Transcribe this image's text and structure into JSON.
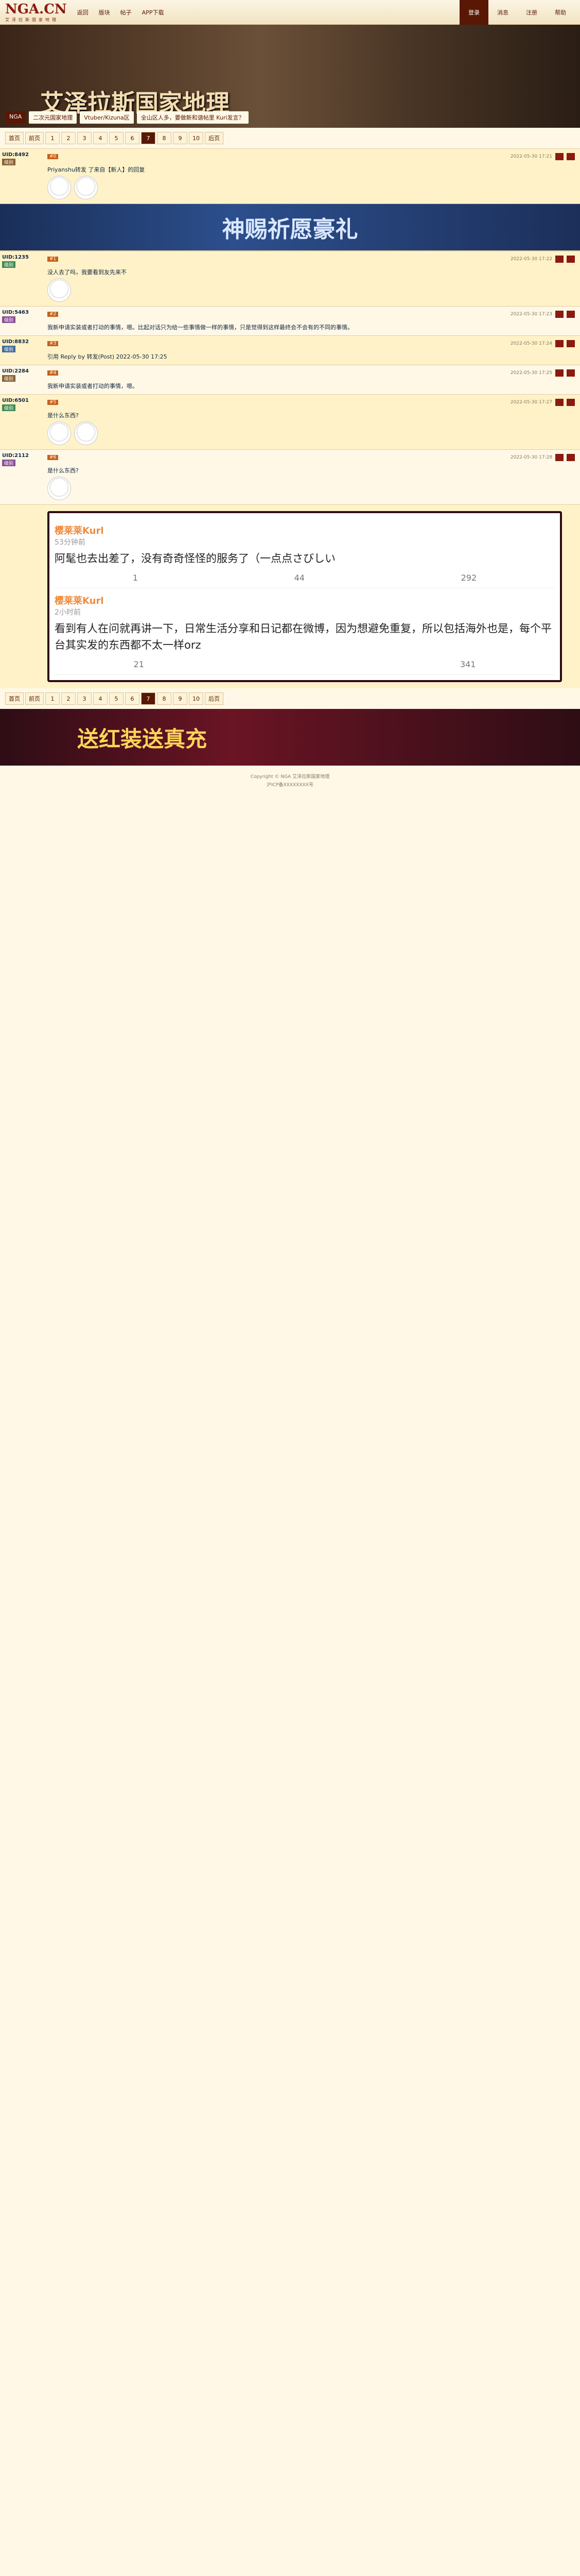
{
  "top": {
    "logo": "NGA.CN",
    "logo_sub": "艾泽拉斯国家地理",
    "nav": [
      "返回",
      "版块",
      "帖子",
      "APP下载"
    ],
    "right": [
      "登录",
      "消息",
      "注册",
      "帮助"
    ]
  },
  "banner": {
    "title": "艾泽拉斯国家地理",
    "bread": [
      "NGA",
      "二次元国家地理",
      "Vtuber/Kizuna区",
      "全山区人多，要做新和谐帖里 Kuri发言？"
    ]
  },
  "pager": [
    "首页",
    "前页",
    "1",
    "2",
    "3",
    "4",
    "5",
    "6",
    "7",
    "8",
    "9",
    "10",
    "后页"
  ],
  "pager_current": "7",
  "posts": [
    {
      "user": "UID:8492",
      "badge": "级别",
      "time": "2022-05-30 17:21",
      "floor": "#0",
      "text": "Priyanshu转发 了来自【新人】的回复",
      "emo": 2,
      "extra": "[emo]"
    },
    {
      "user": "UID:1235",
      "badge": "级别",
      "time": "2022-05-30 17:22",
      "floor": "#1",
      "text": "没人去了吗，我要看到友先来不",
      "emo": 1
    },
    {
      "user": "UID:5463",
      "badge": "级别",
      "time": "2022-05-30 17:23",
      "floor": "#2",
      "text": "我新申请实装或者打动的事情，嗯。比起对话只为给一些事情做一样的事情，只是觉得到这样最终会不会有的不同的事情。",
      "emo": 0
    },
    {
      "user": "UID:8832",
      "badge": "级别",
      "time": "2022-05-30 17:24",
      "floor": "#3",
      "text": "引用 Reply by 转发(Post) 2022-05-30 17:25",
      "emo": 0
    },
    {
      "user": "UID:2284",
      "badge": "级别",
      "time": "2022-05-30 17:25",
      "floor": "#4",
      "text": "我新申请实装或者打动的事情，嗯。",
      "emo": 0
    },
    {
      "user": "UID:6501",
      "badge": "级别",
      "time": "2022-05-30 17:27",
      "floor": "#5",
      "text": "是什么东西?",
      "emo": 2
    },
    {
      "user": "UID:2112",
      "badge": "级别",
      "time": "2022-05-30 17:28",
      "floor": "#6",
      "text": "是什么东西?",
      "emo": 1
    }
  ],
  "ad1": "神赐祈愿豪礼",
  "weibo": [
    {
      "name": "樱莱莱Kurl",
      "time": "53分钟前",
      "text": "阿髦也去出差了，没有奇奇怪怪的服务了（一点点さびしい",
      "stats": [
        "1",
        "44",
        "292"
      ]
    },
    {
      "name": "樱莱莱Kurl",
      "time": "2小时前",
      "text": "看到有人在问就再讲一下，日常生活分享和日记都在微博，因为想避免重复，所以包括海外也是，每个平台其实发的东西都不太一样orz",
      "stats": [
        "21",
        "",
        "341"
      ]
    }
  ],
  "ad2": "送红装送真充",
  "footer": [
    "Copyright © NGA 艾泽拉斯国家地理",
    "沪ICP备XXXXXXXX号"
  ]
}
